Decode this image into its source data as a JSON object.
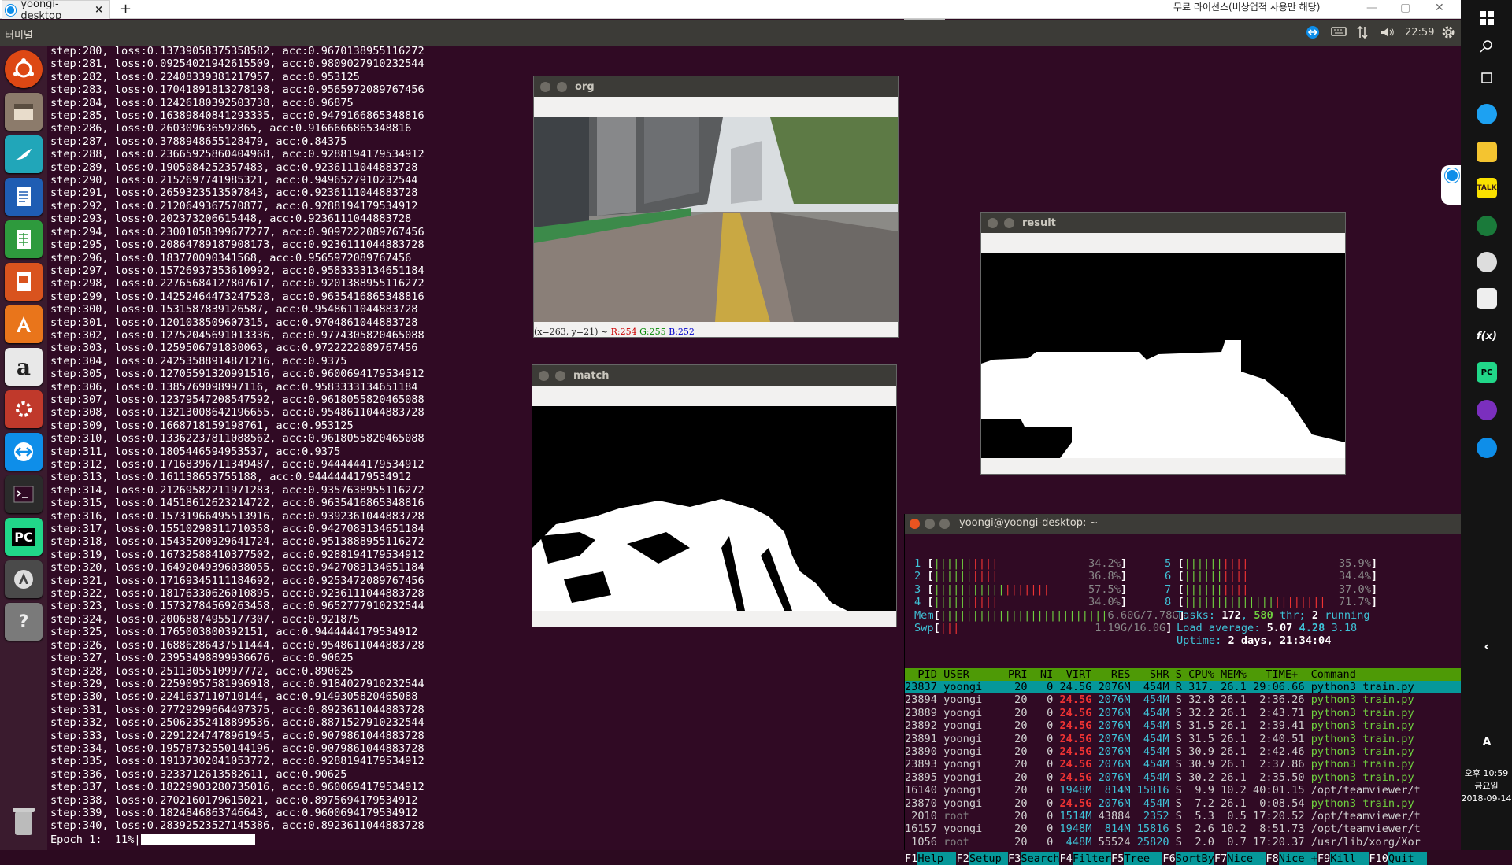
{
  "teamviewer": {
    "tab_label": "yoongi-desktop",
    "close_symbol": "×",
    "new_tab": "+",
    "license_text": "무료 라이선스(비상업적 사용만 해당)",
    "win_controls": [
      "—",
      "▢",
      "✕"
    ],
    "toolbar_glyph": "⤡ ⌄"
  },
  "panel": {
    "title": "터미널",
    "clock": "22:59",
    "indicators": [
      "teamviewer-icon",
      "keyboard-icon",
      "network-icon",
      "volume-icon",
      "gear-icon"
    ]
  },
  "launcher": {
    "items": [
      "dash-icon",
      "files-icon",
      "browser-icon",
      "writer-icon",
      "calc-icon",
      "impress-icon",
      "software-center-icon",
      "amazon-icon",
      "settings-icon",
      "teamviewer-icon",
      "terminal-icon",
      "pycharm-icon",
      "updater-icon",
      "help-icon",
      "trash-icon"
    ]
  },
  "terminal": {
    "lines": [
      "step:280, loss:0.13739058375358582, acc:0.9670138955116272",
      "step:281, loss:0.09254021942615509, acc:0.9809027910232544",
      "step:282, loss:0.22408339381217957, acc:0.953125",
      "step:283, loss:0.17041891813278198, acc:0.9565972089767456",
      "step:284, loss:0.12426180392503738, acc:0.96875",
      "step:285, loss:0.16389840841293335, acc:0.9479166865348816",
      "step:286, loss:0.260309636592865, acc:0.9166666865348816",
      "step:287, loss:0.3788948655128479, acc:0.84375",
      "step:288, loss:0.23665925860404968, acc:0.9288194179534912",
      "step:289, loss:0.1905084252357483, acc:0.9236111044883728",
      "step:290, loss:0.2152697741985321, acc:0.9496527910232544",
      "step:291, loss:0.2659323513507843, acc:0.9236111044883728",
      "step:292, loss:0.2120649367570877, acc:0.9288194179534912",
      "step:293, loss:0.202373206615448, acc:0.9236111044883728",
      "step:294, loss:0.23001058399677277, acc:0.9097222089767456",
      "step:295, loss:0.20864789187908173, acc:0.9236111044883728",
      "step:296, loss:0.183770090341568, acc:0.9565972089767456",
      "step:297, loss:0.15726937353610992, acc:0.9583333134651184",
      "step:298, loss:0.22765684127807617, acc:0.9201388955116272",
      "step:299, loss:0.14252464473247528, acc:0.9635416865348816",
      "step:300, loss:0.1531587839126587, acc:0.9548611044883728",
      "step:301, loss:0.1201038509607315, acc:0.9704861044883728",
      "step:302, loss:0.12752045691013336, acc:0.9774305820465088",
      "step:303, loss:0.1259506791830063, acc:0.9722222089767456",
      "step:304, loss:0.24253588914871216, acc:0.9375",
      "step:305, loss:0.12705591320991516, acc:0.9600694179534912",
      "step:306, loss:0.1385769098997116, acc:0.9583333134651184",
      "step:307, loss:0.12379547208547592, acc:0.9618055820465088",
      "step:308, loss:0.13213008642196655, acc:0.9548611044883728",
      "step:309, loss:0.1668718159198761, acc:0.953125",
      "step:310, loss:0.13362237811088562, acc:0.9618055820465088",
      "step:311, loss:0.1805446594953537, acc:0.9375",
      "step:312, loss:0.17168396711349487, acc:0.9444444179534912",
      "step:313, loss:0.161138653755188, acc:0.9444444179534912",
      "step:314, loss:0.21269582211971283, acc:0.9357638955116272",
      "step:315, loss:0.14518612623214722, acc:0.9635416865348816",
      "step:316, loss:0.15731966495513916, acc:0.9392361044883728",
      "step:317, loss:0.15510298311710358, acc:0.9427083134651184",
      "step:318, loss:0.15435200929641724, acc:0.9513888955116272",
      "step:319, loss:0.16732588410377502, acc:0.9288194179534912",
      "step:320, loss:0.16492049396038055, acc:0.9427083134651184",
      "step:321, loss:0.17169345111184692, acc:0.9253472089767456",
      "step:322, loss:0.18176330626010895, acc:0.9236111044883728",
      "step:323, loss:0.15732784569263458, acc:0.9652777910232544",
      "step:324, loss:0.20068874955177307, acc:0.921875",
      "step:325, loss:0.1765003800392151, acc:0.9444444179534912",
      "step:326, loss:0.16886286437511444, acc:0.9548611044883728",
      "step:327, loss:0.23953498899936676, acc:0.90625",
      "step:328, loss:0.2511305510997772, acc:0.890625",
      "step:329, loss:0.22590957581996918, acc:0.9184027910232544",
      "step:330, loss:0.2241637110710144, acc:0.9149305820465088",
      "step:331, loss:0.27729299664497375, acc:0.8923611044883728",
      "step:332, loss:0.25062352418899536, acc:0.8871527910232544",
      "step:333, loss:0.22912247478961945, acc:0.9079861044883728",
      "step:334, loss:0.19578732550144196, acc:0.9079861044883728",
      "step:335, loss:0.19137302041053772, acc:0.9288194179534912",
      "step:336, loss:0.3233712613582611, acc:0.90625",
      "step:337, loss:0.18229903280735016, acc:0.9600694179534912",
      "step:338, loss:0.2702160179615021, acc:0.8975694179534912",
      "step:339, loss:0.1824846863746643, acc:0.9600694179534912",
      "step:340, loss:0.28392523527145386, acc:0.8923611044883728"
    ],
    "epoch_label": "Epoch 1:  11%|",
    "epoch_progress": 0.11
  },
  "windows": {
    "org": {
      "title": "org",
      "status_prefix": "(x=263, y=21) ~ ",
      "r": "R:254",
      "g": "G:255",
      "b": "B:252"
    },
    "match": {
      "title": "match"
    },
    "result": {
      "title": "result"
    }
  },
  "htop": {
    "title": "yoongi@yoongi-desktop: ~",
    "cpus": [
      {
        "n": "1",
        "bar": "||||||||||",
        "pct": "34.2%"
      },
      {
        "n": "2",
        "bar": "||||||||||",
        "pct": "36.8%"
      },
      {
        "n": "3",
        "bar": "||||||||||||||||||",
        "pct": "57.5%"
      },
      {
        "n": "4",
        "bar": "||||||||||",
        "pct": "34.0%"
      },
      {
        "n": "5",
        "bar": "||||||||||",
        "pct": "35.9%"
      },
      {
        "n": "6",
        "bar": "||||||||||",
        "pct": "34.4%"
      },
      {
        "n": "7",
        "bar": "||||||||||",
        "pct": "37.0%"
      },
      {
        "n": "8",
        "bar": "||||||||||||||||||||||",
        "pct": "71.7%"
      }
    ],
    "mem": {
      "label": "Mem",
      "bar": "||||||||||||||||||||||||||",
      "value": "6.60G/7.78G"
    },
    "swp": {
      "label": "Swp",
      "bar": "|||",
      "value": "1.19G/16.0G"
    },
    "tasks": {
      "label": "Tasks: ",
      "tasks": "172",
      "sep": ", ",
      "thr": "580",
      "thr_label": " thr; ",
      "running": "2",
      "running_label": " running"
    },
    "load": {
      "label": "Load average: ",
      "v1": "5.07",
      "v2": "4.28",
      "v3": "3.18"
    },
    "uptime": {
      "label": "Uptime: ",
      "value": "2 days, 21:34:04"
    },
    "header": "  PID USER      PRI  NI  VIRT   RES   SHR S CPU% MEM%   TIME+  Command",
    "procs": [
      {
        "pid": "23837",
        "user": "yoongi",
        "pri": "20",
        "ni": "0",
        "virt": "24.5G",
        "res": "2076M",
        "shr": "454M",
        "s": "R",
        "cpu": "317.",
        "mem": "26.1",
        "time": "29:06.66",
        "cmd": "python3 train.py",
        "sel": true
      },
      {
        "pid": "23894",
        "user": "yoongi",
        "pri": "20",
        "ni": "0",
        "virt": "24.5G",
        "res": "2076M",
        "shr": "454M",
        "s": "S",
        "cpu": "32.8",
        "mem": "26.1",
        "time": "2:36.26",
        "cmd": "python3 train.py"
      },
      {
        "pid": "23889",
        "user": "yoongi",
        "pri": "20",
        "ni": "0",
        "virt": "24.5G",
        "res": "2076M",
        "shr": "454M",
        "s": "S",
        "cpu": "32.2",
        "mem": "26.1",
        "time": "2:43.71",
        "cmd": "python3 train.py"
      },
      {
        "pid": "23892",
        "user": "yoongi",
        "pri": "20",
        "ni": "0",
        "virt": "24.5G",
        "res": "2076M",
        "shr": "454M",
        "s": "S",
        "cpu": "31.5",
        "mem": "26.1",
        "time": "2:39.41",
        "cmd": "python3 train.py"
      },
      {
        "pid": "23891",
        "user": "yoongi",
        "pri": "20",
        "ni": "0",
        "virt": "24.5G",
        "res": "2076M",
        "shr": "454M",
        "s": "S",
        "cpu": "31.5",
        "mem": "26.1",
        "time": "2:40.51",
        "cmd": "python3 train.py"
      },
      {
        "pid": "23890",
        "user": "yoongi",
        "pri": "20",
        "ni": "0",
        "virt": "24.5G",
        "res": "2076M",
        "shr": "454M",
        "s": "S",
        "cpu": "30.9",
        "mem": "26.1",
        "time": "2:42.46",
        "cmd": "python3 train.py"
      },
      {
        "pid": "23893",
        "user": "yoongi",
        "pri": "20",
        "ni": "0",
        "virt": "24.5G",
        "res": "2076M",
        "shr": "454M",
        "s": "S",
        "cpu": "30.9",
        "mem": "26.1",
        "time": "2:37.86",
        "cmd": "python3 train.py"
      },
      {
        "pid": "23895",
        "user": "yoongi",
        "pri": "20",
        "ni": "0",
        "virt": "24.5G",
        "res": "2076M",
        "shr": "454M",
        "s": "S",
        "cpu": "30.2",
        "mem": "26.1",
        "time": "2:35.50",
        "cmd": "python3 train.py"
      },
      {
        "pid": "16140",
        "user": "yoongi",
        "pri": "20",
        "ni": "0",
        "virt": "1948M",
        "res": "814M",
        "shr": "15816",
        "s": "S",
        "cpu": "9.9",
        "mem": "10.2",
        "time": "40:01.15",
        "cmd": "/opt/teamviewer/t"
      },
      {
        "pid": "23870",
        "user": "yoongi",
        "pri": "20",
        "ni": "0",
        "virt": "24.5G",
        "res": "2076M",
        "shr": "454M",
        "s": "S",
        "cpu": "7.2",
        "mem": "26.1",
        "time": "0:08.54",
        "cmd": "python3 train.py"
      },
      {
        "pid": "2010",
        "user": "root",
        "pri": "20",
        "ni": "0",
        "virt": "1514M",
        "res": "43884",
        "shr": "2352",
        "s": "S",
        "cpu": "5.3",
        "mem": "0.5",
        "time": "17:20.52",
        "cmd": "/opt/teamviewer/t"
      },
      {
        "pid": "16157",
        "user": "yoongi",
        "pri": "20",
        "ni": "0",
        "virt": "1948M",
        "res": "814M",
        "shr": "15816",
        "s": "S",
        "cpu": "2.6",
        "mem": "10.2",
        "time": "8:51.73",
        "cmd": "/opt/teamviewer/t"
      },
      {
        "pid": "1056",
        "user": "root",
        "pri": "20",
        "ni": "0",
        "virt": "448M",
        "res": "55524",
        "shr": "25820",
        "s": "S",
        "cpu": "2.0",
        "mem": "0.7",
        "time": "17:20.37",
        "cmd": "/usr/lib/xorg/Xor"
      }
    ],
    "fkeys": [
      {
        "k": "F1",
        "l": "Help  "
      },
      {
        "k": "F2",
        "l": "Setup "
      },
      {
        "k": "F3",
        "l": "Search"
      },
      {
        "k": "F4",
        "l": "Filter"
      },
      {
        "k": "F5",
        "l": "Tree  "
      },
      {
        "k": "F6",
        "l": "SortBy"
      },
      {
        "k": "F7",
        "l": "Nice -"
      },
      {
        "k": "F8",
        "l": "Nice +"
      },
      {
        "k": "F9",
        "l": "Kill  "
      },
      {
        "k": "F10",
        "l": "Quit  "
      }
    ]
  },
  "windows_taskbar": {
    "icons": [
      "start-icon",
      "search-icon",
      "task-view-icon",
      "chrome-icon",
      "explorer-icon",
      "kakaotalk-icon",
      "app-icon",
      "app2-icon",
      "snip-icon",
      "fx-icon",
      "pycharm-icon",
      "app3-icon",
      "teamviewer-icon"
    ],
    "time": "오후 10:59",
    "day": "금요일",
    "date": "2018-09-14",
    "lang": "A"
  }
}
